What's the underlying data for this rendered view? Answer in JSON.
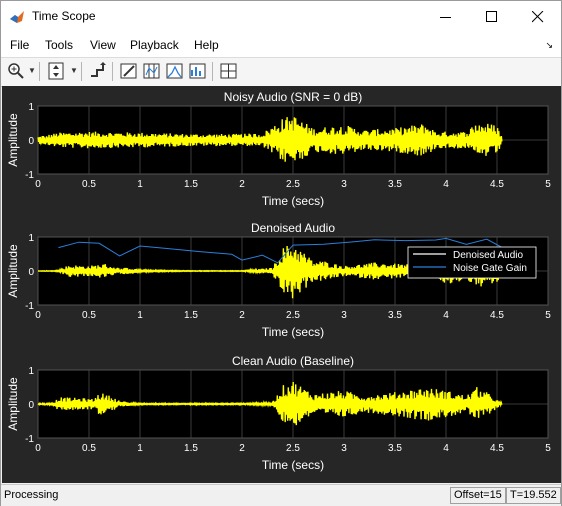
{
  "window": {
    "title": "Time Scope"
  },
  "menu": [
    "File",
    "Tools",
    "View",
    "Playback",
    "Help"
  ],
  "panels": [
    {
      "title": "Noisy Audio (SNR = 0 dB)",
      "ylabel": "Amplitude",
      "xlabel": "Time (secs)"
    },
    {
      "title": "Denoised Audio",
      "ylabel": "Amplitude",
      "xlabel": "Time (secs)",
      "legend": [
        "Denoised Audio",
        "Noise Gate Gain"
      ]
    },
    {
      "title": "Clean Audio (Baseline)",
      "ylabel": "Amplitude",
      "xlabel": "Time (secs)"
    }
  ],
  "x_ticks": [
    "0",
    "0.5",
    "1",
    "1.5",
    "2",
    "2.5",
    "3",
    "3.5",
    "4",
    "4.5",
    "5"
  ],
  "y_ticks": [
    "1",
    "0",
    "-1"
  ],
  "status": {
    "text": "Processing",
    "offset": "Offset=15",
    "time": "T=19.552"
  },
  "colors": {
    "signal": "#ffff00",
    "gain": "#2b7fd9",
    "axes_bg": "#000000",
    "figure_bg": "#262626"
  },
  "chart_data": [
    {
      "type": "line",
      "title": "Noisy Audio (SNR = 0 dB)",
      "xlabel": "Time (secs)",
      "ylabel": "Amplitude",
      "xlim": [
        0,
        5
      ],
      "ylim": [
        -1,
        1
      ],
      "grid": true,
      "series": [
        {
          "x": [
            0,
            0.2,
            0.5,
            1.0,
            1.5,
            2.0,
            2.2,
            2.4,
            2.5,
            2.7,
            3.0,
            3.2,
            3.5,
            3.8,
            3.9,
            4.0,
            4.2,
            4.3,
            4.5,
            4.55
          ],
          "values": [
            0.1,
            0.22,
            0.25,
            0.22,
            0.18,
            0.18,
            0.2,
            0.65,
            0.75,
            0.35,
            0.45,
            0.3,
            0.35,
            0.5,
            0.25,
            0.25,
            0.25,
            0.55,
            0.45,
            0.1
          ]
        }
      ]
    },
    {
      "type": "line",
      "title": "Denoised Audio",
      "xlabel": "Time (secs)",
      "ylabel": "Amplitude",
      "xlim": [
        0,
        5
      ],
      "ylim": [
        -1,
        1
      ],
      "grid": true,
      "legend": "top-right",
      "series": [
        {
          "name": "Denoised Audio",
          "x": [
            0,
            0.2,
            0.3,
            0.5,
            0.65,
            0.8,
            0.9,
            1.0,
            1.5,
            2.0,
            2.3,
            2.4,
            2.5,
            2.7,
            2.8,
            3.0,
            3.3,
            3.6,
            3.9,
            4.0,
            4.2,
            4.3,
            4.5,
            4.55
          ],
          "values": [
            0,
            0.02,
            0.18,
            0.15,
            0.22,
            0.08,
            0.1,
            0.03,
            0.01,
            0.01,
            0.1,
            0.7,
            0.85,
            0.3,
            0.3,
            0.15,
            0.25,
            0.2,
            0.15,
            0.45,
            0.25,
            0.5,
            0.4,
            0
          ]
        },
        {
          "name": "Noise Gate Gain",
          "x": [
            0.2,
            0.4,
            0.6,
            0.8,
            1.0,
            1.2,
            1.6,
            1.9,
            2.0,
            2.2,
            2.35,
            2.5,
            2.8,
            3.1,
            3.3,
            3.6,
            3.9,
            4.0,
            4.2,
            4.4,
            4.55
          ],
          "values": [
            0.7,
            0.85,
            0.8,
            0.45,
            0.75,
            0.7,
            0.55,
            0.5,
            0.3,
            0.45,
            0.25,
            0.75,
            0.8,
            0.85,
            0.92,
            0.9,
            0.92,
            0.95,
            0.8,
            0.95,
            0.7
          ]
        }
      ]
    },
    {
      "type": "line",
      "title": "Clean Audio (Baseline)",
      "xlabel": "Time (secs)",
      "ylabel": "Amplitude",
      "xlim": [
        0,
        5
      ],
      "ylim": [
        -1,
        1
      ],
      "grid": true,
      "series": [
        {
          "x": [
            0,
            0.15,
            0.2,
            0.4,
            0.55,
            0.6,
            0.7,
            0.8,
            0.9,
            1.0,
            1.5,
            2.0,
            2.3,
            2.4,
            2.5,
            2.7,
            3.0,
            3.2,
            3.5,
            3.8,
            4.0,
            4.2,
            4.3,
            4.4,
            4.55
          ],
          "values": [
            0.02,
            0.03,
            0.2,
            0.18,
            0.15,
            0.35,
            0.25,
            0.1,
            0.05,
            0.02,
            0.02,
            0.02,
            0.05,
            0.55,
            0.7,
            0.3,
            0.4,
            0.25,
            0.35,
            0.5,
            0.4,
            0.25,
            0.5,
            0.35,
            0.02
          ]
        }
      ]
    }
  ]
}
